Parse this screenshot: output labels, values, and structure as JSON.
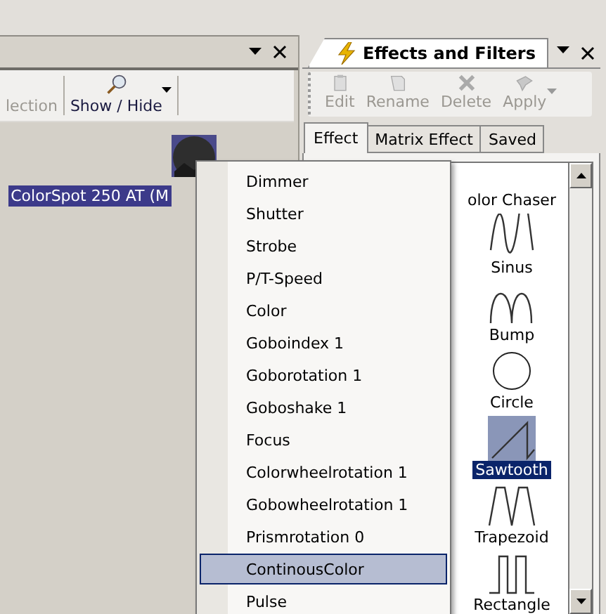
{
  "left_panel": {
    "toolbar": [
      {
        "label": "lection",
        "disabled": true,
        "dropdown": false,
        "kind": "none"
      },
      {
        "label": "Show / Hide",
        "disabled": false,
        "dropdown": true,
        "kind": "magnifier"
      }
    ],
    "fixture": {
      "label": "ColorSpot 250 AT (M",
      "selected": true
    }
  },
  "right_panel": {
    "title": "Effects and Filters",
    "toolbar": [
      {
        "label": "Edit",
        "disabled": true,
        "kind": "clipboard"
      },
      {
        "label": "Rename",
        "disabled": true,
        "kind": "page"
      },
      {
        "label": "Delete",
        "disabled": true,
        "kind": "cross"
      },
      {
        "label": "Apply",
        "disabled": true,
        "kind": "apply"
      }
    ],
    "tabs": [
      {
        "label": "Effect",
        "selected": true
      },
      {
        "label": "Matrix Effect",
        "selected": false
      },
      {
        "label": "Saved",
        "selected": false
      }
    ],
    "effects": [
      {
        "label": "olor Chaser",
        "kind": "none",
        "selected": false
      },
      {
        "label": "Sinus",
        "kind": "sine",
        "selected": false
      },
      {
        "label": "Bump",
        "kind": "bump",
        "selected": false
      },
      {
        "label": "Circle",
        "kind": "circle",
        "selected": false
      },
      {
        "label": "Sawtooth",
        "kind": "sawtooth",
        "selected": true
      },
      {
        "label": "Trapezoid",
        "kind": "trapezoid",
        "selected": false
      },
      {
        "label": "Rectangle",
        "kind": "rectangle",
        "selected": false
      }
    ]
  },
  "context_menu": {
    "items": [
      {
        "label": "Dimmer",
        "selected": false
      },
      {
        "label": "Shutter",
        "selected": false
      },
      {
        "label": "Strobe",
        "selected": false
      },
      {
        "label": "P/T-Speed",
        "selected": false
      },
      {
        "label": "Color",
        "selected": false
      },
      {
        "label": "Goboindex 1",
        "selected": false
      },
      {
        "label": "Goborotation 1",
        "selected": false
      },
      {
        "label": "Goboshake 1",
        "selected": false
      },
      {
        "label": "Focus",
        "selected": false
      },
      {
        "label": "Colorwheelrotation 1",
        "selected": false
      },
      {
        "label": "Gobowheelrotation 1",
        "selected": false
      },
      {
        "label": "Prismrotation 0",
        "selected": false
      },
      {
        "label": "ContinousColor",
        "selected": true
      },
      {
        "label": "Pulse",
        "selected": false
      }
    ]
  }
}
